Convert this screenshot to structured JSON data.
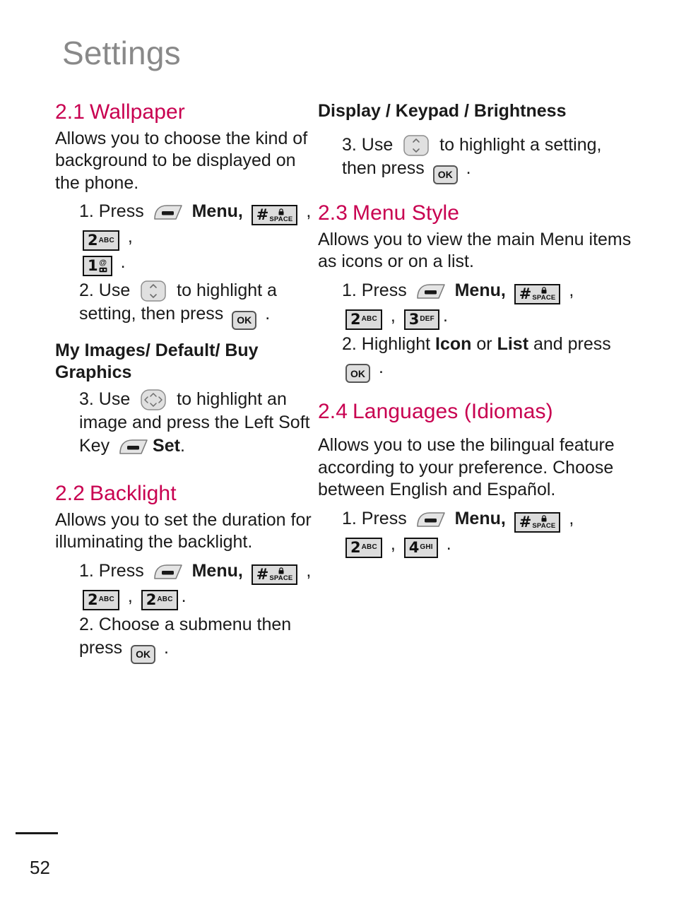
{
  "page": {
    "title": "Settings",
    "number": "52"
  },
  "icons": {
    "softkey": "left-soft-key-icon",
    "ok": "OK",
    "nav_updown": "up-down-navigation-key-icon",
    "nav_4way": "four-way-navigation-key-icon",
    "key_hash": {
      "digit": "#",
      "letters": "SPACE",
      "lock": "lock-icon"
    },
    "key_1": {
      "digit": "1",
      "at": "@",
      "voicemail": "voicemail-icon"
    },
    "key_2": {
      "digit": "2",
      "letters": "ABC"
    },
    "key_3": {
      "digit": "3",
      "letters": "DEF"
    },
    "key_4": {
      "digit": "4",
      "letters": "GHI"
    }
  },
  "left_column": {
    "s21": {
      "number": "2.1",
      "title": "Wallpaper",
      "intro": "Allows you to choose the kind of background to be displayed on the phone.",
      "step1_pre": "1. Press",
      "step1_menu": "Menu,",
      "step1_comma": ",",
      "step1_period": ".",
      "step2_pre": "2. Use",
      "step2_mid": "to highlight a setting, then press",
      "step2_period": ".",
      "subhead": "My Images/ Default/ Buy Graphics",
      "step3_pre": "3. Use",
      "step3_mid": "to highlight an image and press the Left Soft Key",
      "step3_set": "Set",
      "step3_period": "."
    },
    "s22": {
      "number": "2.2",
      "title": "Backlight",
      "intro": "Allows you to set the duration for illuminating the backlight.",
      "step1_pre": "1. Press",
      "step1_menu": "Menu,",
      "step1_comma": ",",
      "step1_period": ".",
      "step2_pre": "2. Choose a submenu then press",
      "step2_period": "."
    }
  },
  "right_column": {
    "subhead_display": "Display / Keypad / Brightness",
    "step3_pre": "3. Use",
    "step3_mid": "to highlight a setting, then press",
    "step3_period": ".",
    "s23": {
      "number": "2.3",
      "title": "Menu Style",
      "intro": "Allows you to view the main Menu items as icons or on a list.",
      "step1_pre": "1. Press",
      "step1_menu": "Menu,",
      "step1_comma": ",",
      "step1_period": ".",
      "step2_pre": "2. Highlight",
      "step2_icon": "Icon",
      "step2_or": "or",
      "step2_list": "List",
      "step2_and": "and press",
      "step2_period": "."
    },
    "s24": {
      "number": "2.4",
      "title": "Languages (Idiomas)",
      "intro": "Allows you to use the bilingual feature according to your preference. Choose between English and Español.",
      "step1_pre": "1. Press",
      "step1_menu": "Menu,",
      "step1_comma": ",",
      "step1_period": "."
    }
  },
  "colors": {
    "heading": "#c80050",
    "title": "#898989",
    "body": "#1a1a1a",
    "key_fill": "#dcdcdc"
  }
}
